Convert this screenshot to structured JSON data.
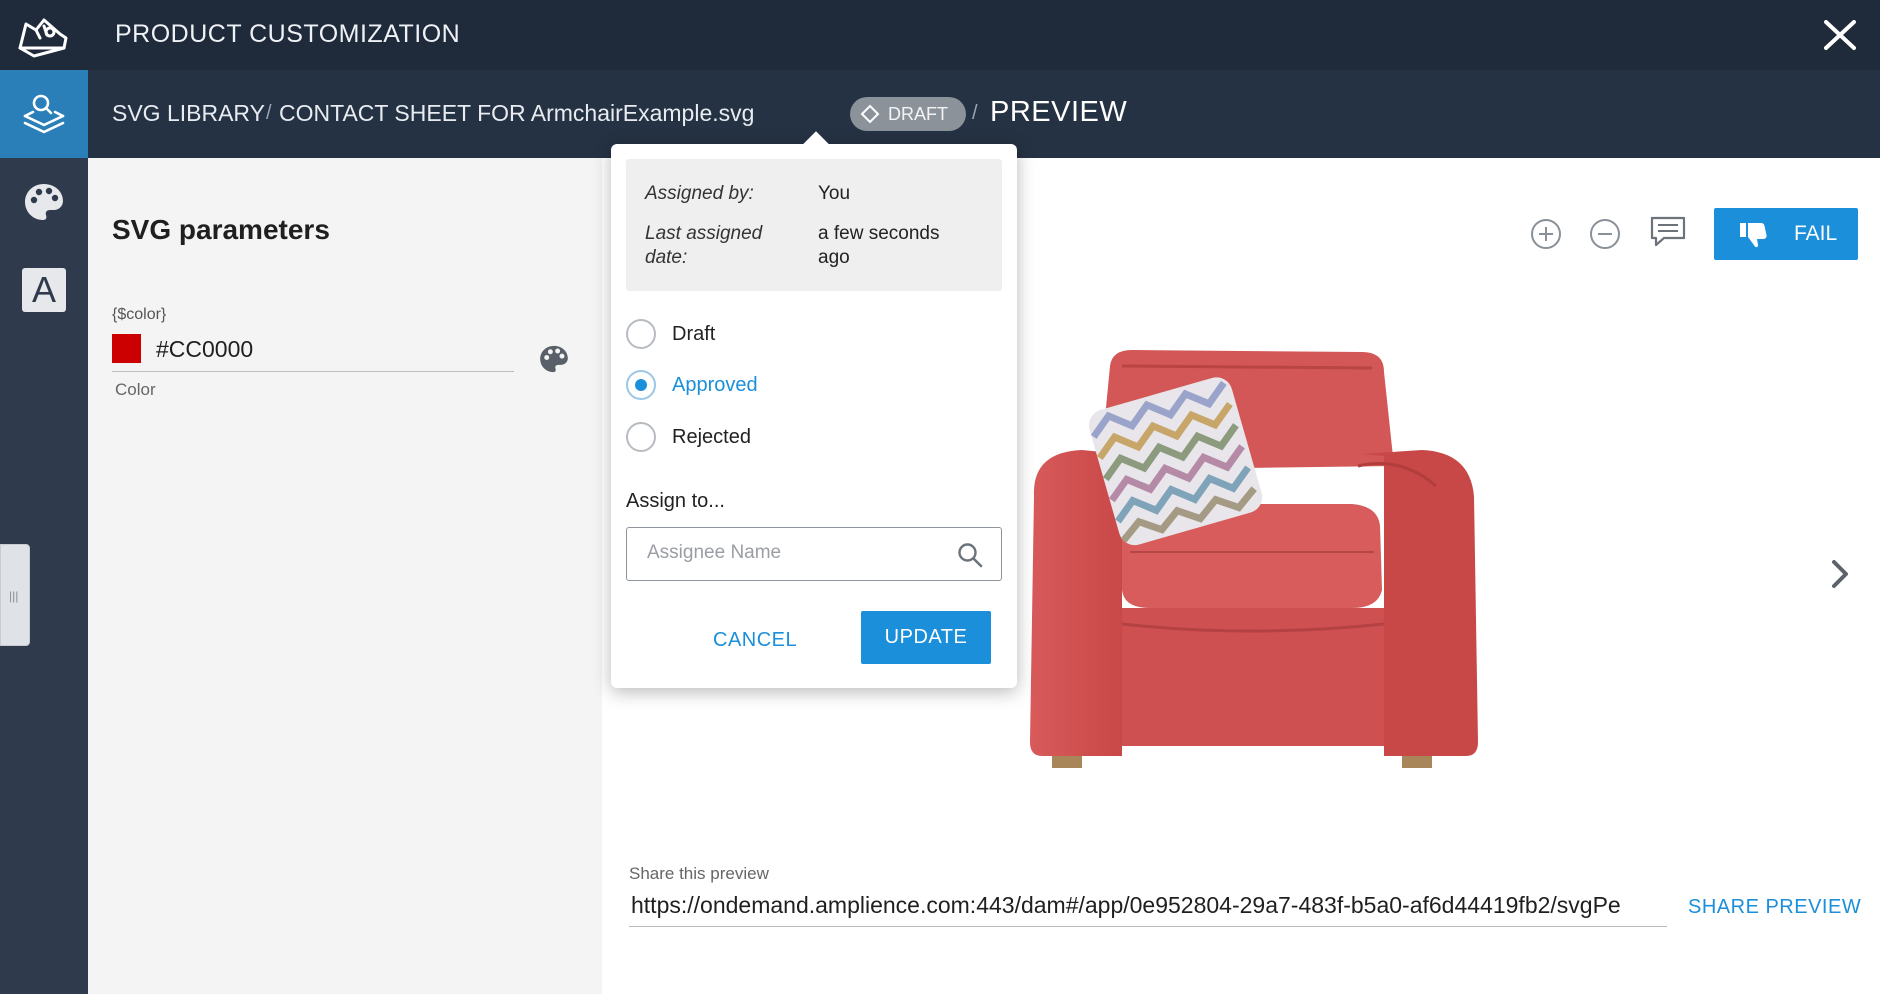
{
  "app": {
    "title": "PRODUCT CUSTOMIZATION",
    "logo_icon": "sneaker-logo-icon",
    "close_icon": "close-icon"
  },
  "rail": {
    "items": [
      {
        "name": "layers-search",
        "icon": "layers-search-icon",
        "active": true
      },
      {
        "name": "palette",
        "icon": "palette-icon",
        "active": false
      },
      {
        "name": "text",
        "icon": "text-icon",
        "glyph": "A",
        "active": false
      }
    ],
    "handle_glyph": "|||"
  },
  "breadcrumb": {
    "items": [
      "SVG LIBRARY",
      "CONTACT SHEET FOR ArmchairExample.svg"
    ],
    "separator": "/",
    "status_badge": "DRAFT",
    "current": "PREVIEW"
  },
  "params": {
    "title": "SVG parameters",
    "fields": [
      {
        "key": "{$color}",
        "value": "#CC0000",
        "label": "Color",
        "swatch_color": "#cc0000"
      }
    ]
  },
  "preview": {
    "toolbar": {
      "zoom_in_icon": "zoom-in-icon",
      "zoom_out_icon": "zoom-out-icon",
      "comment_icon": "comment-icon",
      "fail_label": "FAIL",
      "fail_icon": "thumbs-down-icon"
    },
    "next_icon": "chevron-right-icon",
    "share": {
      "label": "Share this preview",
      "url": "https://ondemand.amplience.com:443/dam#/app/0e952804-29a7-483f-b5a0-af6d44419fb2/svgPe",
      "button": "SHARE PREVIEW"
    }
  },
  "status_popup": {
    "assigned_by_label": "Assigned by:",
    "assigned_by_value": "You",
    "last_assigned_label_1": "Last assigned",
    "last_assigned_label_2": "date:",
    "last_assigned_value_1": "a few seconds",
    "last_assigned_value_2": "ago",
    "options": [
      {
        "label": "Draft",
        "checked": false
      },
      {
        "label": "Approved",
        "checked": true
      },
      {
        "label": "Rejected",
        "checked": false
      }
    ],
    "assign_label": "Assign to...",
    "assign_placeholder": "Assignee Name",
    "assign_value": "",
    "cancel_label": "CANCEL",
    "update_label": "UPDATE"
  },
  "colors": {
    "accent": "#1b8fd9",
    "topbar": "#1f2a3a",
    "crumbbar": "#253243",
    "rail": "#2f3b4d",
    "swatch": "#cc0000"
  }
}
